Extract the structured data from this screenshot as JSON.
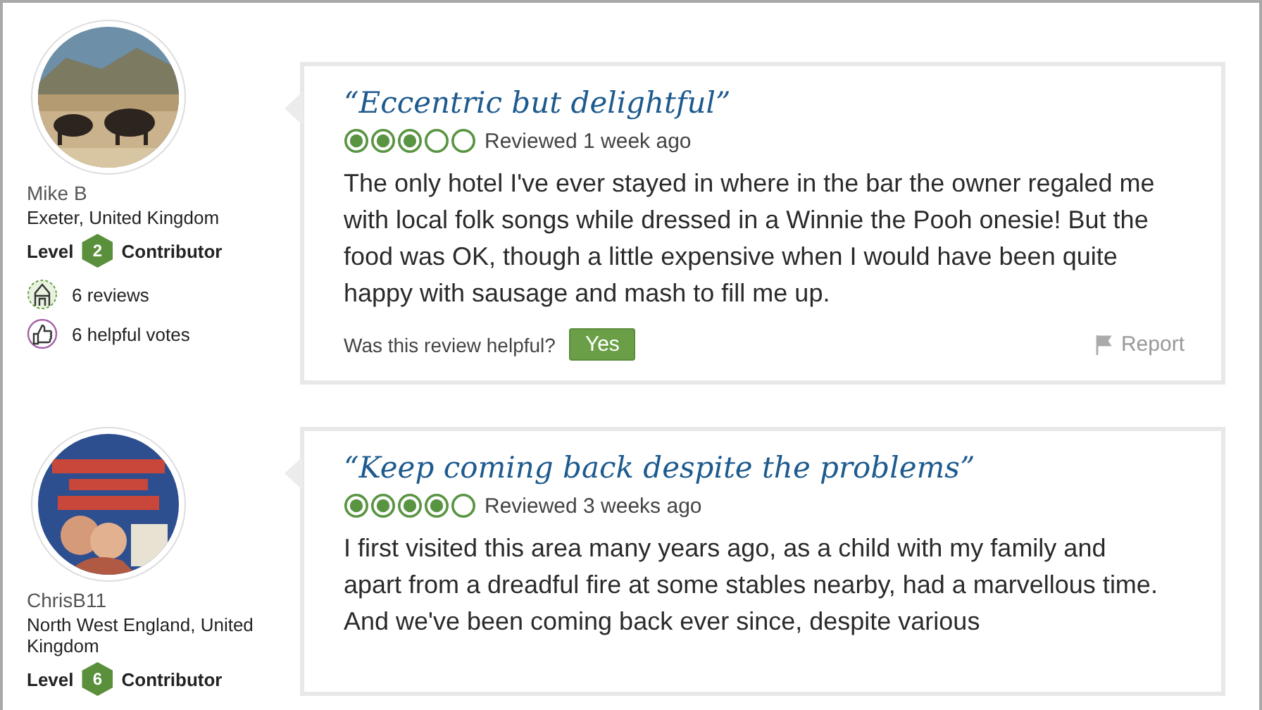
{
  "reviews": [
    {
      "reviewer": {
        "name": "Mike B",
        "location": "Exeter, United Kingdom",
        "level_label": "Level",
        "level": "2",
        "badge_label": "Contributor",
        "stats": [
          {
            "kind": "reviews",
            "text": "6 reviews"
          },
          {
            "kind": "votes",
            "text": "6 helpful votes"
          }
        ]
      },
      "title": "“Eccentric but delightful”",
      "stars": 3,
      "date": "Reviewed 1 week ago",
      "body": "The only hotel I've ever stayed in where in the bar the owner regaled me with local folk songs while dressed in a Winnie the Pooh onesie! But the food was OK, though a little expensive when I would have been quite happy with sausage and mash to fill me up.",
      "helpful_prompt": "Was this review helpful?",
      "yes_button": "Yes",
      "report": "Report"
    },
    {
      "reviewer": {
        "name": "ChrisB11",
        "location": "North West England, United Kingdom",
        "level_label": "Level",
        "level": "6",
        "badge_label": "Contributor"
      },
      "title": "“Keep coming back despite the problems”",
      "stars": 4,
      "date": "Reviewed 3 weeks ago",
      "body": "I first visited this area many years ago, as a child with my family and apart from a dreadful fire at some stables nearby, had a marvellous time. And we've been coming back ever since, despite various"
    }
  ]
}
